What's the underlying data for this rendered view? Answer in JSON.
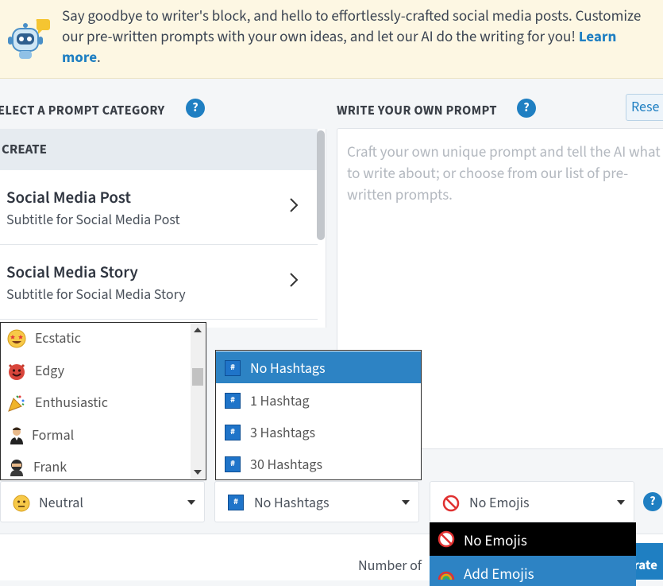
{
  "banner": {
    "text": "Say goodbye to writer's block, and hello to effortlessly-crafted social media posts. Customize our pre-written prompts with your own ideas, and let our AI do the writing for you!",
    "link": "Learn more",
    "trailing": "."
  },
  "category_section": {
    "heading": "ELECT A PROMPT CATEGORY",
    "group_header": "CREATE",
    "items": [
      {
        "title": "Social Media Post",
        "subtitle": "Subtitle for Social Media Post"
      },
      {
        "title": "Social Media Story",
        "subtitle": "Subtitle for Social Media Story"
      }
    ]
  },
  "prompt_section": {
    "heading": "WRITE YOUR OWN PROMPT",
    "reset_label": "Rese",
    "placeholder": "Craft your own unique prompt and tell the AI what to write about; or choose from our list of pre-written prompts."
  },
  "tone_options": [
    {
      "label": "Ecstatic",
      "icon": "star-struck-face-icon"
    },
    {
      "label": "Edgy",
      "icon": "smiling-devil-icon"
    },
    {
      "label": "Enthusiastic",
      "icon": "party-popper-icon"
    },
    {
      "label": "Formal",
      "icon": "person-in-tuxedo-icon"
    },
    {
      "label": "Frank",
      "icon": "ninja-icon"
    }
  ],
  "hashtag_options": [
    {
      "label": "No Hashtags",
      "selected": true
    },
    {
      "label": "1 Hashtag",
      "selected": false
    },
    {
      "label": "3 Hashtags",
      "selected": false
    },
    {
      "label": "30 Hashtags",
      "selected": false
    }
  ],
  "selects": {
    "tone_value": "Neutral",
    "hashtags_value": "No Hashtags",
    "emojis_value": "No Emojis"
  },
  "emoji_options": [
    {
      "label": "No Emojis",
      "icon": "no-entry-icon"
    },
    {
      "label": "Add Emojis",
      "icon": "rainbow-icon"
    }
  ],
  "footer": {
    "number_of_label": "Number of",
    "generate_label": "rate"
  },
  "colors": {
    "accent": "#1f7fc2",
    "selected_row": "#2d83c4",
    "banner_bg": "#fdf7e3"
  }
}
